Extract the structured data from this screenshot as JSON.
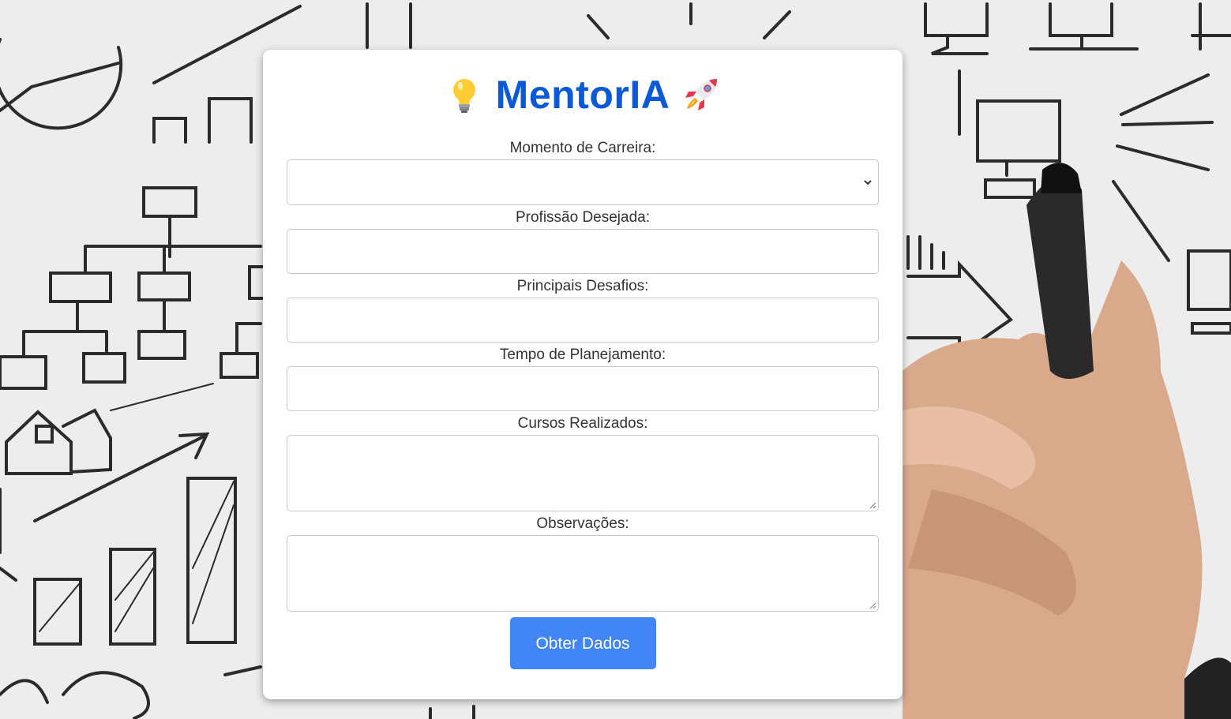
{
  "app": {
    "title": "MentorIA",
    "title_icon_left": "lightbulb-icon",
    "title_icon_right": "rocket-icon",
    "accent_color": "#0a5ad8",
    "button_color": "#4285f4"
  },
  "form": {
    "fields": [
      {
        "label": "Momento de Carreira:",
        "type": "select",
        "value": ""
      },
      {
        "label": "Profissão Desejada:",
        "type": "text",
        "value": ""
      },
      {
        "label": "Principais Desafios:",
        "type": "text",
        "value": ""
      },
      {
        "label": "Tempo de Planejamento:",
        "type": "text",
        "value": ""
      },
      {
        "label": "Cursos Realizados:",
        "type": "textarea",
        "value": ""
      },
      {
        "label": "Observações:",
        "type": "textarea",
        "value": ""
      }
    ],
    "submit_label": "Obter Dados"
  }
}
